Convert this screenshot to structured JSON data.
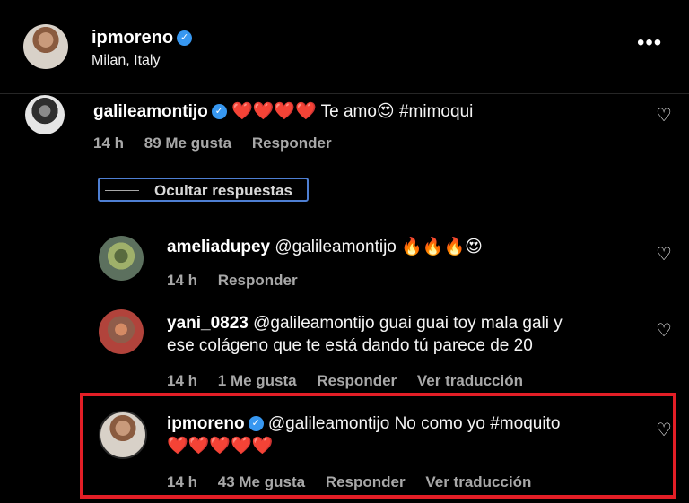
{
  "post": {
    "username": "ipmoreno",
    "location": "Milan, Italy",
    "more_label": "•••"
  },
  "comments": [
    {
      "username": "galileamontijo",
      "text": "❤️❤️❤️❤️ Te amo😍 #mimoqui",
      "time": "14 h",
      "likes": "89 Me gusta",
      "reply": "Responder"
    }
  ],
  "hide_replies": "Ocultar respuestas",
  "replies": [
    {
      "username": "ameliadupey",
      "text": "@galileamontijo 🔥🔥🔥😍",
      "time": "14 h",
      "reply": "Responder"
    },
    {
      "username": "yani_0823",
      "text_line1": "@galileamontijo guai guai toy mala gali y",
      "text_line2": "ese colágeno que te está dando tú parece de 20",
      "time": "14 h",
      "likes": "1 Me gusta",
      "reply": "Responder",
      "translate": "Ver traducción"
    },
    {
      "username": "ipmoreno",
      "text_line1": "@galileamontijo No como yo #moquito",
      "text_line2": "❤️❤️❤️❤️❤️",
      "time": "14 h",
      "likes": "43 Me gusta",
      "reply": "Responder",
      "translate": "Ver traducción"
    }
  ],
  "icons": {
    "verified": "verified-badge-icon",
    "heart": "heart-outline-icon",
    "more": "more-options-icon"
  },
  "colors": {
    "verified": "#3797f0",
    "highlight": "#e31e26"
  }
}
